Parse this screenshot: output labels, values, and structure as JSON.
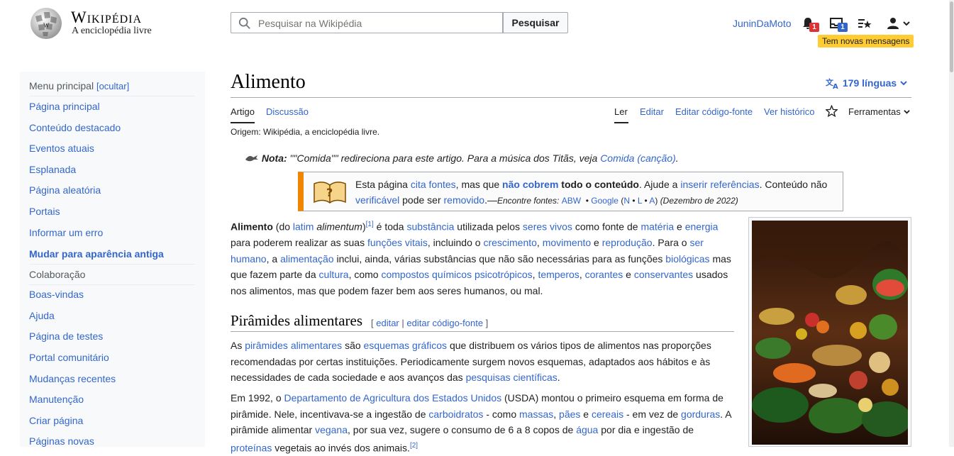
{
  "header": {
    "wordmark": "Wikipédia",
    "tagline": "A enciclopédia livre",
    "search_placeholder": "Pesquisar na Wikipédia",
    "search_button": "Pesquisar",
    "username": "JuninDaMoto",
    "notifications_count": "1",
    "alerts_count": "1",
    "new_messages": "Tem novas mensagens"
  },
  "sidebar": {
    "menu_title": "Menu principal",
    "hide_label": "[ocultar]",
    "items": [
      "Página principal",
      "Conteúdo destacado",
      "Eventos atuais",
      "Esplanada",
      "Página aleatória",
      "Portais",
      "Informar um erro"
    ],
    "old_look": "Mudar para aparência antiga",
    "collab_title": "Colaboração",
    "collab_items": [
      "Boas-vindas",
      "Ajuda",
      "Página de testes",
      "Portal comunitário",
      "Mudanças recentes",
      "Manutenção",
      "Criar página",
      "Páginas novas"
    ]
  },
  "article": {
    "title": "Alimento",
    "languages": "179 línguas",
    "tabs_left": [
      "Artigo",
      "Discussão"
    ],
    "tabs_right": [
      "Ler",
      "Editar",
      "Editar código-fonte",
      "Ver histórico"
    ],
    "tools": "Ferramentas",
    "origin": "Origem: Wikipédia, a enciclopédia livre.",
    "note_label": "Nota:",
    "note_text": " \"\"Comida\"\" redireciona para este artigo. Para a música dos Titãs, veja ",
    "note_link": "Comida (canção)",
    "ambox": {
      "t1": "Esta página ",
      "l1": "cita fontes",
      "t2": ", mas que ",
      "l2": "não cobrem",
      "t3": " todo o conteúdo",
      "t4": ". Ajude a ",
      "l3": "inserir referências",
      "t5": ". Conteúdo não ",
      "l4": "verificável",
      "t6": " pode ser ",
      "l5": "removido",
      "t7": ".—",
      "find": "Encontre fontes: ",
      "abw": "ABW",
      "google": "Google",
      "n": "N",
      "l": "L",
      "a": "A",
      "date": "(Dezembro de 2022)"
    },
    "section_title": "Pirâmides alimentares",
    "section_edit": "editar",
    "section_edit_src": "editar código-fonte"
  },
  "colors": {
    "link": "#3366cc",
    "badge_red": "#d33",
    "badge_blue": "#3366cc",
    "tooltip_bg": "#fc3",
    "ambox_border": "#f28500"
  },
  "icons": [
    "search-icon",
    "bell-icon",
    "tray-icon",
    "watchlist-icon",
    "user-icon",
    "chevron-down-icon",
    "translate-icon",
    "star-icon",
    "book-icon",
    "note-icon"
  ]
}
